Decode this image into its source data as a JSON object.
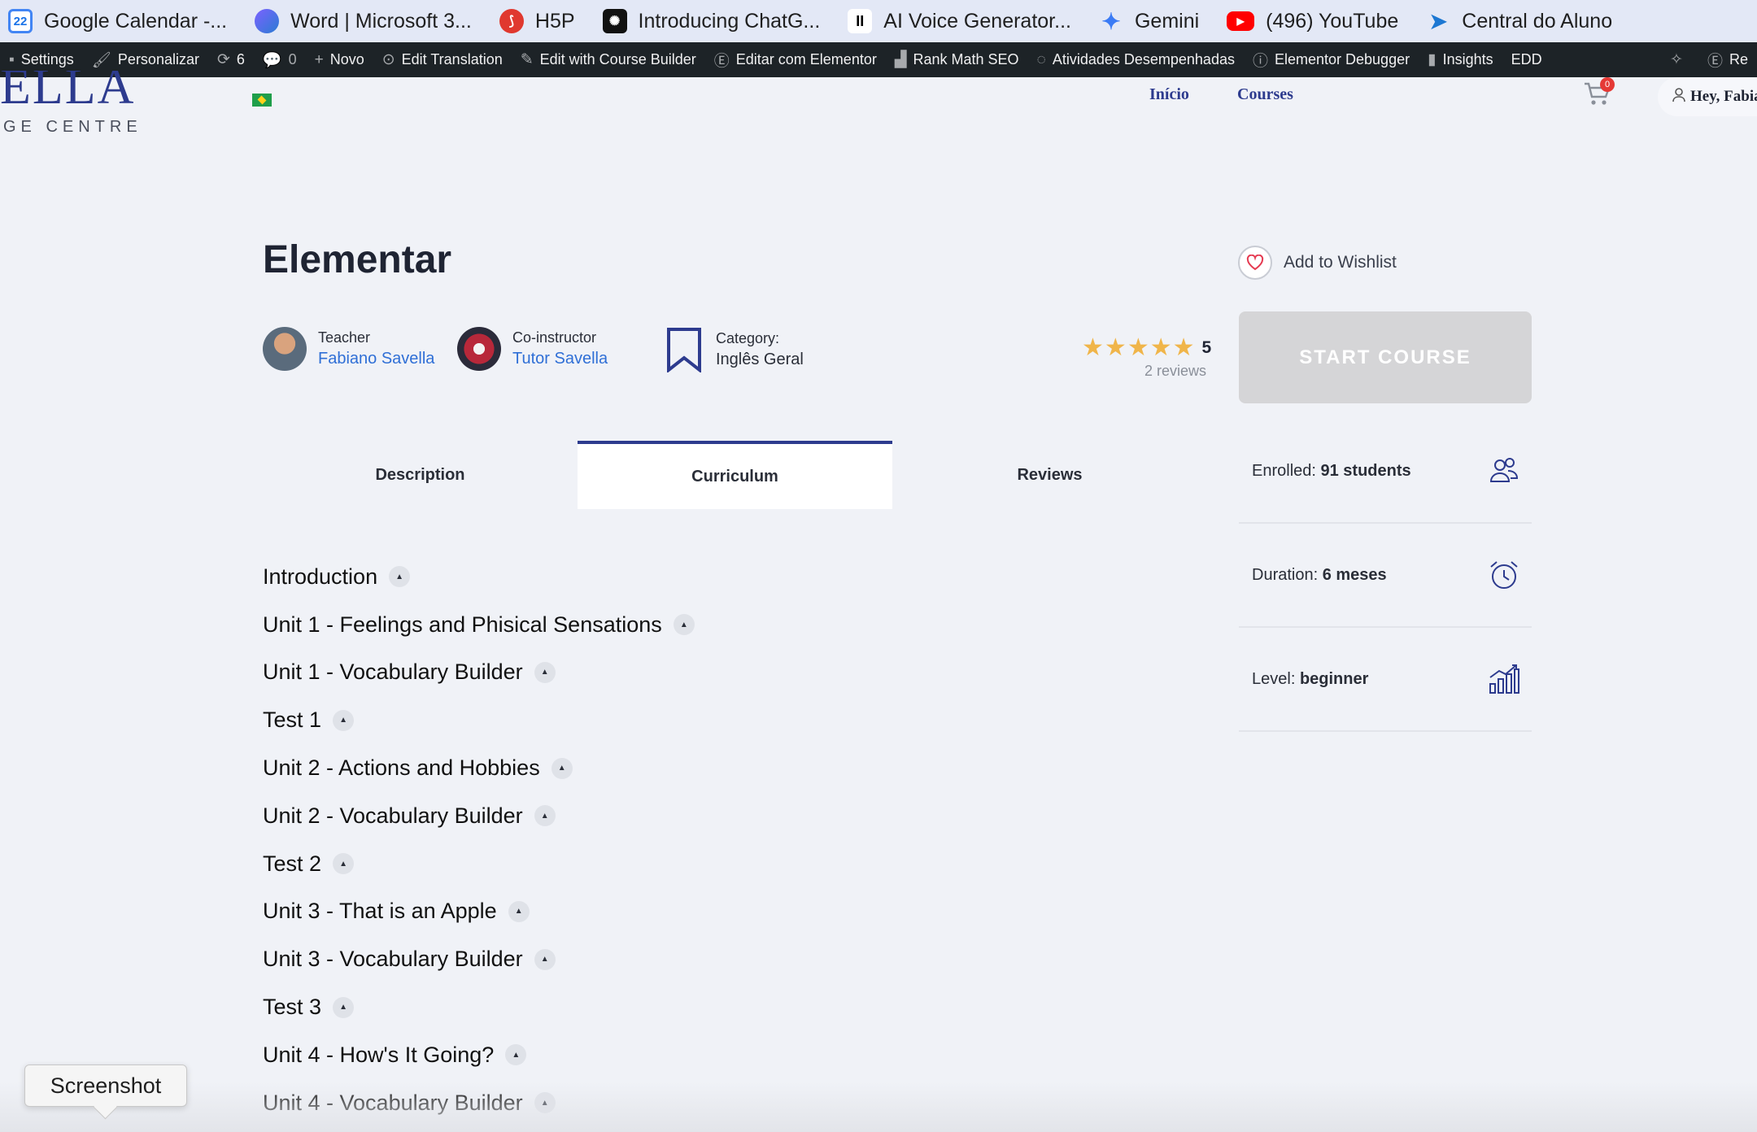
{
  "bookmarks": [
    {
      "label": "Google Calendar -...",
      "icon": "google-calendar-icon",
      "glyph": "22"
    },
    {
      "label": "Word | Microsoft 3...",
      "icon": "microsoft-copilot-icon",
      "glyph": ""
    },
    {
      "label": "H5P",
      "icon": "h5p-icon",
      "glyph": "⟆"
    },
    {
      "label": "Introducing ChatG...",
      "icon": "chatgpt-icon",
      "glyph": "✺"
    },
    {
      "label": "AI Voice Generator...",
      "icon": "elevenlabs-icon",
      "glyph": "II"
    },
    {
      "label": "Gemini",
      "icon": "gemini-icon",
      "glyph": "✦"
    },
    {
      "label": "(496) YouTube",
      "icon": "youtube-icon",
      "glyph": "▶"
    },
    {
      "label": "Central do Aluno",
      "icon": "central-aluno-icon",
      "glyph": "➤"
    }
  ],
  "adminbar": {
    "items": [
      {
        "label": "Settings",
        "icon": "settings-icon",
        "glyph": "▪"
      },
      {
        "label": "Personalizar",
        "icon": "brush-icon",
        "glyph": "🖌"
      },
      {
        "label": "6",
        "icon": "updates-icon",
        "glyph": "⟳"
      },
      {
        "label": "0",
        "icon": "comments-icon",
        "glyph": "💬"
      },
      {
        "label": "Novo",
        "icon": "plus-icon",
        "glyph": "+"
      },
      {
        "label": "Edit Translation",
        "icon": "translate-icon",
        "glyph": "⊙"
      },
      {
        "label": "Edit with Course Builder",
        "icon": "pencil-icon",
        "glyph": "✎"
      },
      {
        "label": "Editar com Elementor",
        "icon": "elementor-icon",
        "glyph": "Ⓔ"
      },
      {
        "label": "Rank Math SEO",
        "icon": "rank-math-icon",
        "glyph": "▟"
      },
      {
        "label": "Atividades Desempenhadas",
        "icon": "activity-icon",
        "glyph": "◌"
      },
      {
        "label": "Elementor Debugger",
        "icon": "info-icon",
        "glyph": "ⓘ"
      },
      {
        "label": "Insights",
        "icon": "insights-icon",
        "glyph": "▮"
      },
      {
        "label": "EDD",
        "icon": "",
        "glyph": ""
      },
      {
        "label": "",
        "icon": "sparkle-icon",
        "glyph": "✧"
      },
      {
        "label": "Re",
        "icon": "elementor-icon",
        "glyph": "Ⓔ"
      }
    ]
  },
  "header": {
    "logo_main": "ELLA",
    "logo_sub": "GE CENTRE",
    "nav": [
      "Início",
      "Courses"
    ],
    "cart_count": "0",
    "user_greeting": "Hey, Fabia"
  },
  "course": {
    "title": "Elementar",
    "teacher_label": "Teacher",
    "teacher_name": "Fabiano Savella",
    "coinstructor_label": "Co-instructor",
    "coinstructor_name": "Tutor Savella",
    "category_label": "Category:",
    "category_value": "Inglês Geral",
    "rating_value": "5",
    "rating_stars": 5,
    "reviews_count": "2 reviews",
    "wishlist_label": "Add to Wishlist",
    "start_button": "START COURSE"
  },
  "tabs": [
    {
      "label": "Description",
      "active": false
    },
    {
      "label": "Curriculum",
      "active": true
    },
    {
      "label": "Reviews",
      "active": false
    }
  ],
  "sidebar": [
    {
      "label": "Enrolled:",
      "value": "91 students",
      "icon": "students-icon"
    },
    {
      "label": "Duration:",
      "value": "6 meses",
      "icon": "alarm-clock-icon"
    },
    {
      "label": "Level:",
      "value": "beginner",
      "icon": "level-chart-icon"
    }
  ],
  "curriculum": [
    "Introduction",
    "Unit 1 - Feelings and Phisical Sensations",
    "Unit 1 - Vocabulary Builder",
    "Test 1",
    "Unit 2 - Actions and Hobbies",
    "Unit 2 - Vocabulary Builder",
    "Test 2",
    "Unit 3 - That is an Apple",
    "Unit 3 - Vocabulary Builder",
    "Test 3",
    "Unit 4 - How's It Going?",
    "Unit 4 - Vocabulary Builder"
  ],
  "tooltip": "Screenshot",
  "colors": {
    "brand": "#2d3b8e",
    "link": "#2f6fd6",
    "star": "#f0b54a",
    "admin_bg": "#1d2327"
  }
}
